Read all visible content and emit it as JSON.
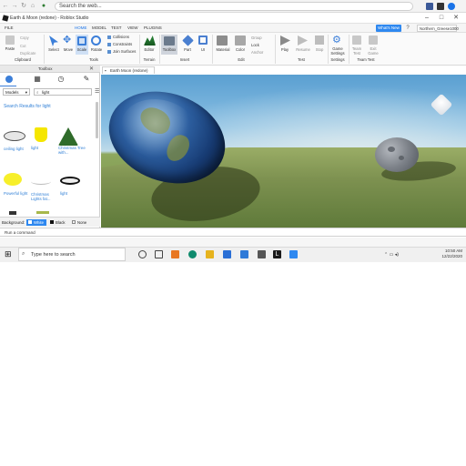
{
  "browser": {
    "address_text": "Search the web...",
    "nav_icons": [
      "back-icon",
      "forward-icon",
      "refresh-icon",
      "home-icon",
      "lock-icon"
    ]
  },
  "window": {
    "title": "Earth & Moon (redone) - Roblox Studio",
    "controls": [
      "–",
      "□",
      "✕"
    ]
  },
  "menu": {
    "tabs": [
      "FILE",
      "HOME",
      "MODEL",
      "TEST",
      "VIEW",
      "PLUGINS"
    ],
    "active_tab": "HOME",
    "whats_new": "What's New",
    "username": "Northern_Greese1000"
  },
  "ribbon": {
    "clipboard": {
      "paste": "Paste",
      "copy": "Copy",
      "cut": "Cut",
      "duplicate": "Duplicate",
      "group_label": "Clipboard"
    },
    "tools": {
      "select": "Select",
      "move": "Move",
      "scale": "Scale",
      "rotate": "Rotate",
      "collisions": "Collisions",
      "constraints": "Constraints",
      "join_surfaces": "Join Surfaces",
      "group_label": "Tools"
    },
    "terrain": {
      "editor": "Editor",
      "group_label": "Terrain"
    },
    "insert": {
      "toolbox": "Toolbox",
      "part": "Part",
      "ui": "UI",
      "group_label": "Insert"
    },
    "edit": {
      "material": "Material",
      "color": "Color",
      "group": "Group",
      "lock": "Lock",
      "anchor": "Anchor",
      "group_label": "Edit"
    },
    "test": {
      "play": "Play",
      "resume": "Resume",
      "stop": "Stop",
      "group_label": "Test"
    },
    "settings": {
      "game_settings": "Game Settings",
      "group_label": "Settings"
    },
    "team_test": {
      "team_test": "Team Test",
      "exit_game": "Exit Game",
      "group_label": "Team Test"
    }
  },
  "toolbox": {
    "title": "Toolbox",
    "filter": "Models",
    "search": "light",
    "results_heading": "Search Results for light",
    "items": [
      {
        "label": "ceiling light",
        "color": "#dcdcdc"
      },
      {
        "label": "light",
        "color": "#f5e600"
      },
      {
        "label": "Christmas Tree with...",
        "color": "#2f6b2a"
      },
      {
        "label": "Powerful light",
        "color": "#f7ef2a"
      },
      {
        "label": "Christmas Lights fat...",
        "color": "#e8e8e8"
      },
      {
        "label": "light",
        "color": "#111111"
      }
    ],
    "background_label": "Background:",
    "bg_options": [
      "White",
      "Black",
      "None"
    ],
    "bg_selected": "White"
  },
  "viewport": {
    "tab_label": "Earth Moon (redone)",
    "sky_color": "#7fb8e0",
    "ground_color": "#7a9050"
  },
  "command_bar": {
    "placeholder": "Run a command"
  },
  "taskbar": {
    "search_placeholder": "Type here to search",
    "time": "10:50 AM",
    "date": "12/22/2020"
  }
}
